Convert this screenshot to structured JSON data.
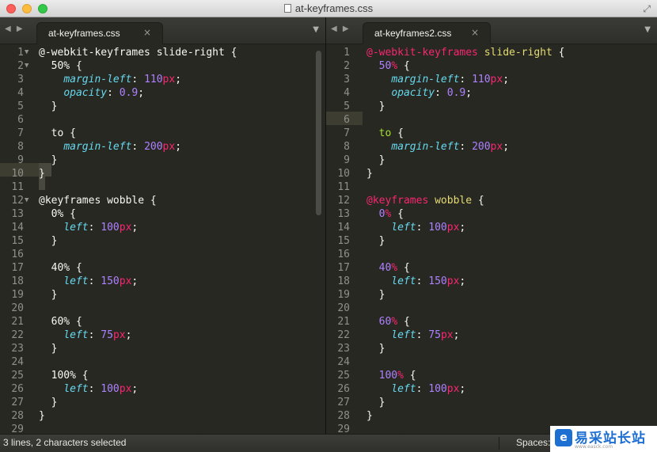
{
  "window": {
    "title": "at-keyframes.css"
  },
  "left_pane": {
    "tab_label": "at-keyframes.css",
    "lines": [
      [
        [
          "at",
          "@-webkit-keyframes "
        ],
        [
          "sel-t",
          "slide-right "
        ],
        [
          "punc",
          "{"
        ]
      ],
      [
        [
          "punc",
          "  "
        ],
        [
          "pct",
          "50%"
        ],
        [
          "punc",
          " {"
        ]
      ],
      [
        [
          "punc",
          "    "
        ],
        [
          "prop",
          "margin-left"
        ],
        [
          "punc",
          ": "
        ],
        [
          "num",
          "110"
        ],
        [
          "unit",
          "px"
        ],
        [
          "punc",
          ";"
        ]
      ],
      [
        [
          "punc",
          "    "
        ],
        [
          "prop",
          "opacity"
        ],
        [
          "punc",
          ": "
        ],
        [
          "num",
          "0.9"
        ],
        [
          "punc",
          ";"
        ]
      ],
      [
        [
          "punc",
          "  }"
        ]
      ],
      [],
      [
        [
          "punc",
          "  "
        ],
        [
          "sel-t",
          "to"
        ],
        [
          "punc",
          " {"
        ]
      ],
      [
        [
          "punc",
          "    "
        ],
        [
          "prop",
          "margin-left"
        ],
        [
          "punc",
          ": "
        ],
        [
          "num",
          "200"
        ],
        [
          "unit",
          "px"
        ],
        [
          "punc",
          ";"
        ]
      ],
      [
        [
          "punc",
          "  }"
        ]
      ],
      [
        [
          "punc",
          "}"
        ]
      ],
      [],
      [
        [
          "at",
          "@keyframes "
        ],
        [
          "sel-t",
          "wobble "
        ],
        [
          "punc",
          "{"
        ]
      ],
      [
        [
          "punc",
          "  "
        ],
        [
          "pct",
          "0%"
        ],
        [
          "punc",
          " {"
        ]
      ],
      [
        [
          "punc",
          "    "
        ],
        [
          "prop",
          "left"
        ],
        [
          "punc",
          ": "
        ],
        [
          "num",
          "100"
        ],
        [
          "unit",
          "px"
        ],
        [
          "punc",
          ";"
        ]
      ],
      [
        [
          "punc",
          "  }"
        ]
      ],
      [],
      [
        [
          "punc",
          "  "
        ],
        [
          "pct",
          "40%"
        ],
        [
          "punc",
          " {"
        ]
      ],
      [
        [
          "punc",
          "    "
        ],
        [
          "prop",
          "left"
        ],
        [
          "punc",
          ": "
        ],
        [
          "num",
          "150"
        ],
        [
          "unit",
          "px"
        ],
        [
          "punc",
          ";"
        ]
      ],
      [
        [
          "punc",
          "  }"
        ]
      ],
      [],
      [
        [
          "punc",
          "  "
        ],
        [
          "pct",
          "60%"
        ],
        [
          "punc",
          " {"
        ]
      ],
      [
        [
          "punc",
          "    "
        ],
        [
          "prop",
          "left"
        ],
        [
          "punc",
          ": "
        ],
        [
          "num",
          "75"
        ],
        [
          "unit",
          "px"
        ],
        [
          "punc",
          ";"
        ]
      ],
      [
        [
          "punc",
          "  }"
        ]
      ],
      [],
      [
        [
          "punc",
          "  "
        ],
        [
          "pct",
          "100%"
        ],
        [
          "punc",
          " {"
        ]
      ],
      [
        [
          "punc",
          "    "
        ],
        [
          "prop",
          "left"
        ],
        [
          "punc",
          ": "
        ],
        [
          "num",
          "100"
        ],
        [
          "unit",
          "px"
        ],
        [
          "punc",
          ";"
        ]
      ],
      [
        [
          "punc",
          "  }"
        ]
      ],
      [
        [
          "punc",
          "}"
        ]
      ],
      []
    ]
  },
  "right_pane": {
    "tab_label": "at-keyframes2.css",
    "lines": [
      [
        [
          "at",
          "@-webkit-keyframes "
        ],
        [
          "kname",
          "slide-right "
        ],
        [
          "punc",
          "{"
        ]
      ],
      [
        [
          "punc",
          "  "
        ],
        [
          "pct",
          "50"
        ],
        [
          "pctsign",
          "%"
        ],
        [
          "punc",
          " {"
        ]
      ],
      [
        [
          "punc",
          "    "
        ],
        [
          "prop",
          "margin-left"
        ],
        [
          "punc",
          ": "
        ],
        [
          "num",
          "110"
        ],
        [
          "unit",
          "px"
        ],
        [
          "punc",
          ";"
        ]
      ],
      [
        [
          "punc",
          "    "
        ],
        [
          "prop",
          "opacity"
        ],
        [
          "punc",
          ": "
        ],
        [
          "num",
          "0.9"
        ],
        [
          "punc",
          ";"
        ]
      ],
      [
        [
          "punc",
          "  }"
        ]
      ],
      [],
      [
        [
          "punc",
          "  "
        ],
        [
          "to",
          "to"
        ],
        [
          "punc",
          " {"
        ]
      ],
      [
        [
          "punc",
          "    "
        ],
        [
          "prop",
          "margin-left"
        ],
        [
          "punc",
          ": "
        ],
        [
          "num",
          "200"
        ],
        [
          "unit",
          "px"
        ],
        [
          "punc",
          ";"
        ]
      ],
      [
        [
          "punc",
          "  }"
        ]
      ],
      [
        [
          "punc",
          "}"
        ]
      ],
      [],
      [
        [
          "at",
          "@keyframes "
        ],
        [
          "kname",
          "wobble "
        ],
        [
          "punc",
          "{"
        ]
      ],
      [
        [
          "punc",
          "  "
        ],
        [
          "pct",
          "0"
        ],
        [
          "pctsign",
          "%"
        ],
        [
          "punc",
          " {"
        ]
      ],
      [
        [
          "punc",
          "    "
        ],
        [
          "prop",
          "left"
        ],
        [
          "punc",
          ": "
        ],
        [
          "num",
          "100"
        ],
        [
          "unit",
          "px"
        ],
        [
          "punc",
          ";"
        ]
      ],
      [
        [
          "punc",
          "  }"
        ]
      ],
      [],
      [
        [
          "punc",
          "  "
        ],
        [
          "pct",
          "40"
        ],
        [
          "pctsign",
          "%"
        ],
        [
          "punc",
          " {"
        ]
      ],
      [
        [
          "punc",
          "    "
        ],
        [
          "prop",
          "left"
        ],
        [
          "punc",
          ": "
        ],
        [
          "num",
          "150"
        ],
        [
          "unit",
          "px"
        ],
        [
          "punc",
          ";"
        ]
      ],
      [
        [
          "punc",
          "  }"
        ]
      ],
      [],
      [
        [
          "punc",
          "  "
        ],
        [
          "pct",
          "60"
        ],
        [
          "pctsign",
          "%"
        ],
        [
          "punc",
          " {"
        ]
      ],
      [
        [
          "punc",
          "    "
        ],
        [
          "prop",
          "left"
        ],
        [
          "punc",
          ": "
        ],
        [
          "num",
          "75"
        ],
        [
          "unit",
          "px"
        ],
        [
          "punc",
          ";"
        ]
      ],
      [
        [
          "punc",
          "  }"
        ]
      ],
      [],
      [
        [
          "punc",
          "  "
        ],
        [
          "pct",
          "100"
        ],
        [
          "pctsign",
          "%"
        ],
        [
          "punc",
          " {"
        ]
      ],
      [
        [
          "punc",
          "    "
        ],
        [
          "prop",
          "left"
        ],
        [
          "punc",
          ": "
        ],
        [
          "num",
          "100"
        ],
        [
          "unit",
          "px"
        ],
        [
          "punc",
          ";"
        ]
      ],
      [
        [
          "punc",
          "  }"
        ]
      ],
      [
        [
          "punc",
          "}"
        ]
      ],
      []
    ]
  },
  "status_bar": {
    "selection": "3 lines, 2 characters selected",
    "spaces": "Spaces:"
  },
  "watermark": {
    "text": "易采站长站",
    "sub": "www.easck.com"
  }
}
